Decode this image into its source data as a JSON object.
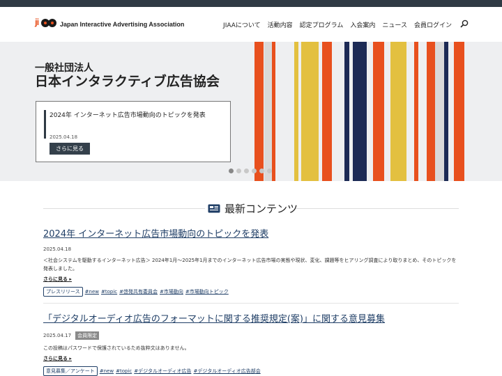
{
  "logo": {
    "mark_text": "ji",
    "name": "Japan Interactive Advertising Association"
  },
  "nav": {
    "items": [
      "JIAAについて",
      "活動内容",
      "認定プログラム",
      "入会案内",
      "ニュース",
      "会員ログイン"
    ],
    "search_icon": "search-icon"
  },
  "hero": {
    "subtitle": "一般社団法人",
    "title": "日本インタラクティブ広告協会",
    "card": {
      "title": "2024年 インターネット広告市場動向のトピックを発表",
      "date": "2025.04.18",
      "button": "さらに見る"
    },
    "slides": 6,
    "active_slide": 0,
    "stripe_colors": [
      "#e8501e",
      "#d9d9d9",
      "#e8501e",
      "#e3c040",
      "#1c2a55",
      "#e8501e"
    ]
  },
  "section": {
    "title": "最新コンテンツ",
    "icon": "newspaper-icon"
  },
  "articles": [
    {
      "title": "2024年 インターネット広告市場動向のトピックを発表",
      "date": "2025.04.18",
      "badge": "",
      "body": "＜社会システムを駆動するインターネット広告＞ 2024年1月〜2025年1月までのインターネット広告市場の実態や現状、変化、課題等をヒアリング調査により取りまとめ、そのトピックを発表しました。",
      "more": "さらに見る",
      "category": "プレスリリース",
      "tags": [
        "#new",
        "#topic",
        "#啓発共有委員会",
        "#市場動向",
        "#市場動向トピック"
      ]
    },
    {
      "title": "「デジタルオーディオ広告のフォーマットに関する推奨規定(案)」に関する意見募集",
      "date": "2025.04.17",
      "badge": "会員限定",
      "body": "この投稿はパスワードで保護されているため抜粋文はありません。",
      "more": "さらに見る",
      "category": "意見募集／アンケート",
      "tags": [
        "#new",
        "#topic",
        "#デジタルオーディオ広告",
        "#デジタルオーディオ広告部会"
      ]
    }
  ]
}
